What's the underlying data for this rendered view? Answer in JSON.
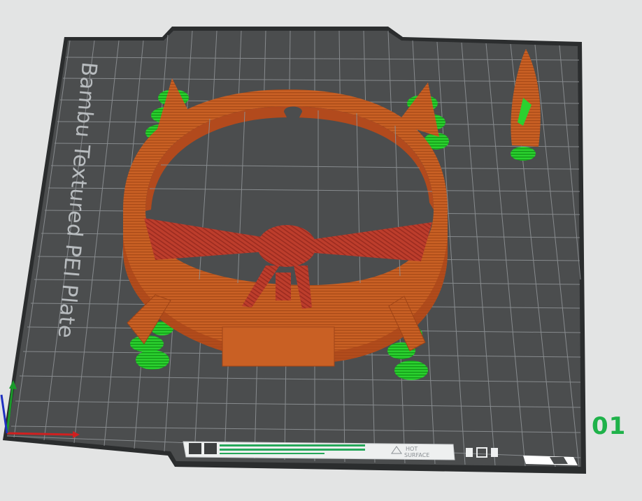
{
  "plate": {
    "name": "Bambu Textured PEI Plate",
    "number": "01",
    "badge_line1": "HOT",
    "badge_line2": "SURFACE"
  },
  "colors": {
    "background": "#e3e4e4",
    "bed": "#4b4d4e",
    "bed_frame": "#2b2d2e",
    "grid": "#8e9295",
    "model_orange": "#c75f22",
    "model_red": "#b9372a",
    "support_green": "#22c42b",
    "axis_x": "#d02020",
    "axis_y": "#1a9a2a",
    "axis_z": "#2030c0",
    "plate_number": "#1fb24a"
  },
  "icons": [
    "axis-gizmo-icon",
    "hot-surface-warning-icon",
    "bed-clip-icon"
  ]
}
